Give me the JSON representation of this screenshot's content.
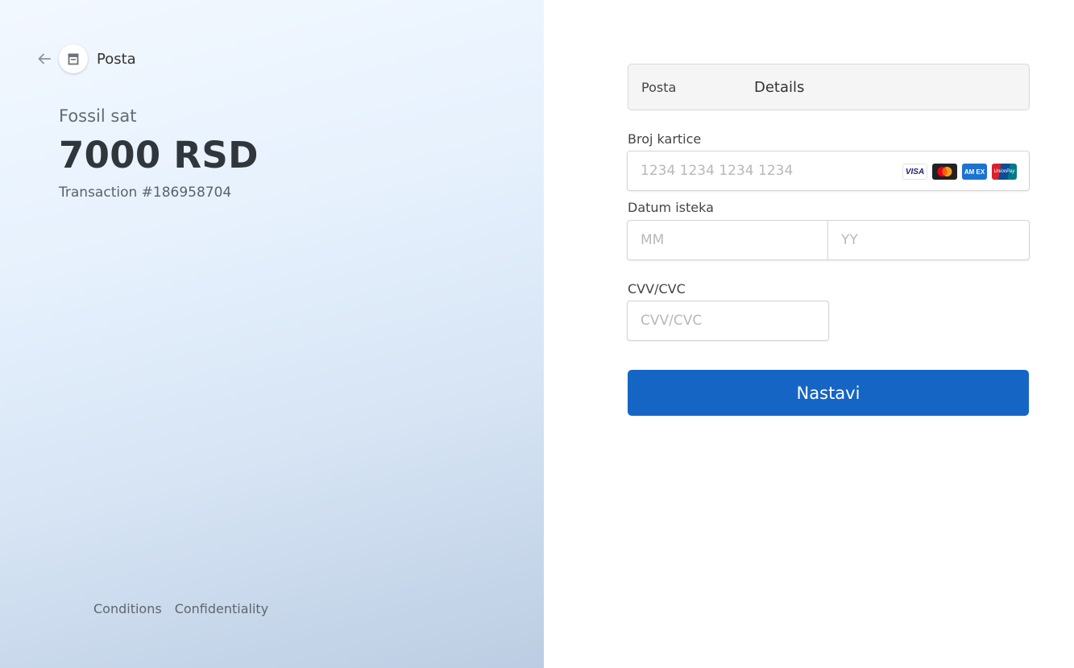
{
  "merchant": {
    "name": "Posta"
  },
  "order": {
    "product": "Fossil sat",
    "amount": "7000 RSD",
    "transaction": "Transaction #186958704"
  },
  "footer": {
    "conditions": "Conditions",
    "confidentiality": "Confidentiality"
  },
  "form": {
    "details_bar": {
      "merchant": "Posta",
      "label": "Details"
    },
    "card_number": {
      "label": "Broj kartice",
      "placeholder": "1234 1234 1234 1234",
      "value": ""
    },
    "card_logos": [
      {
        "name": "visa-logo",
        "text": "VISA"
      },
      {
        "name": "mastercard-logo",
        "text": ""
      },
      {
        "name": "amex-logo",
        "text": "AM EX"
      },
      {
        "name": "unionpay-logo",
        "text": "UnionPay"
      }
    ],
    "expiry": {
      "label": "Datum isteka",
      "month_placeholder": "MM",
      "year_placeholder": "YY"
    },
    "cvv": {
      "label": "CVV/CVC",
      "placeholder": "CVV/CVC"
    },
    "submit_label": "Nastavi"
  },
  "colors": {
    "primary_button": "#1565c4",
    "panel_gradient_start": "#f3f8ff",
    "panel_gradient_end": "#bccde3"
  },
  "icons": {
    "back": "arrow-left-icon",
    "merchant": "store-icon"
  }
}
